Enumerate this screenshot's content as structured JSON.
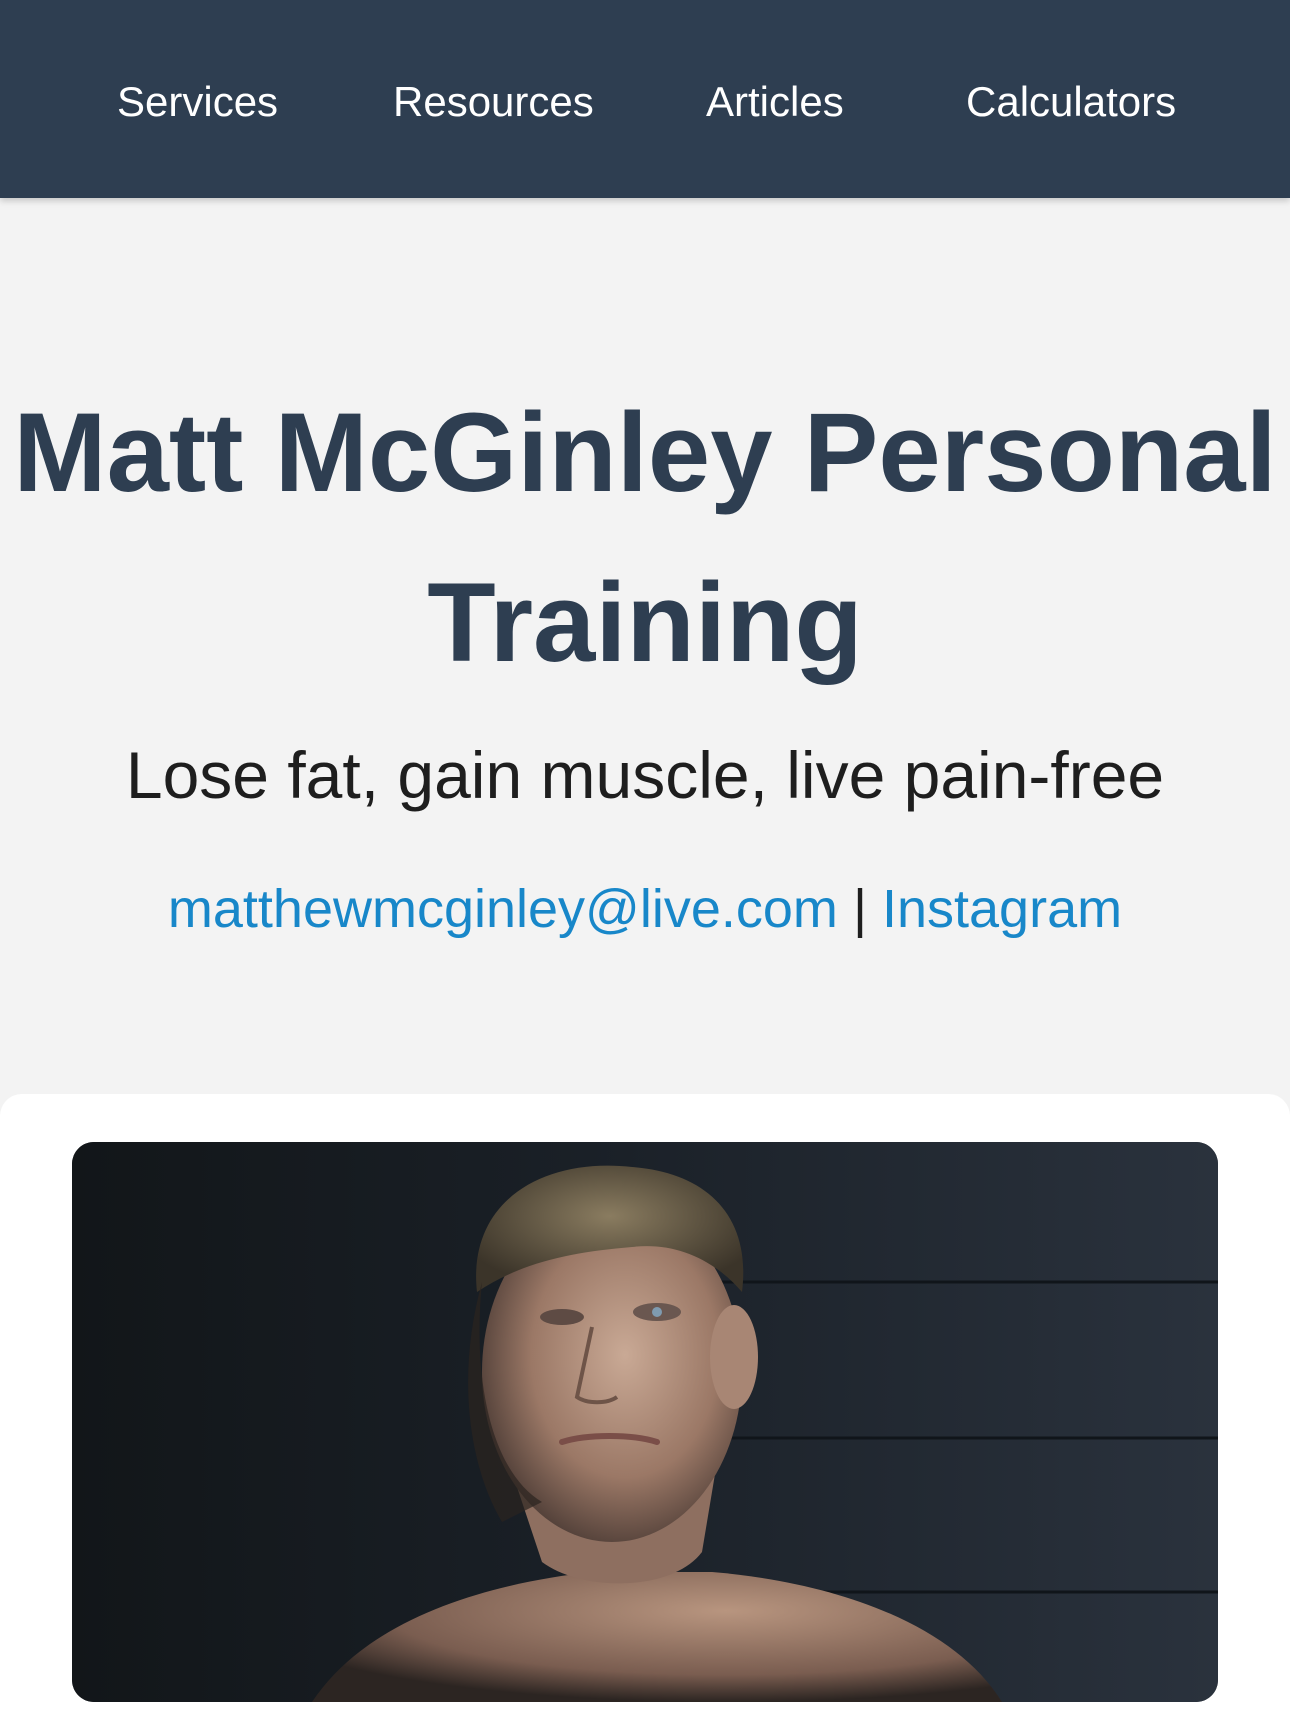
{
  "nav": {
    "items": [
      {
        "label": "Services"
      },
      {
        "label": "Resources"
      },
      {
        "label": "Articles"
      },
      {
        "label": "Calculators"
      }
    ]
  },
  "hero": {
    "title": "Matt McGinley Personal Training",
    "tagline": "Lose fat, gain muscle, live pain-free"
  },
  "contact": {
    "email": "matthewmcginley@live.com",
    "separator": "|",
    "instagram_label": "Instagram"
  },
  "colors": {
    "navbar_bg": "#2e3e51",
    "title": "#2e3e51",
    "link": "#1887c9",
    "page_bg": "#f3f3f3"
  }
}
